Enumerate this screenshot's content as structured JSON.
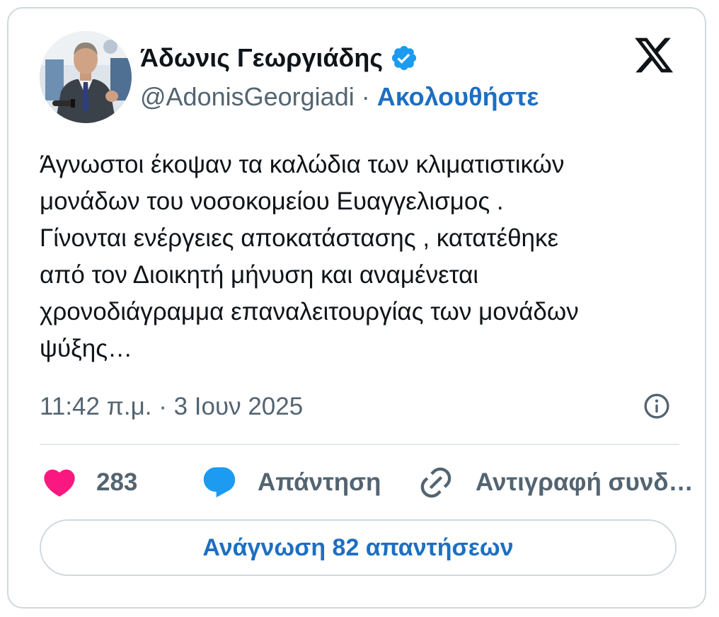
{
  "author": {
    "display_name": "Άδωνις Γεωργιάδης",
    "handle": "@AdonisGeorgiadi",
    "separator": "·",
    "follow_label": "Ακολουθήστε"
  },
  "tweet": {
    "text": "Άγνωστοι έκοψαν τα καλώδια των κλιματιστικών\nμονάδων του νοσοκομείου Ευαγγελισμος .\nΓίνονται ενέργειες αποκατάστασης , κατατέθηκε\nαπό τον Διοικητή μήνυση και αναμένεται\nχρονοδιάγραμμα επαναλειτουργίας των μονάδων\nψύξης…",
    "timestamp": "11:42 π.μ. · 3 Ιουν 2025"
  },
  "actions": {
    "like_count": "283",
    "reply_label": "Απάντηση",
    "copy_link_label": "Αντιγραφή συνδ…"
  },
  "read_replies_label": "Ανάγνωση 82 απαντήσεων",
  "icons": {
    "verified": "verified-badge-icon",
    "brand": "x-logo-icon",
    "info": "info-icon",
    "like": "heart-icon",
    "reply": "speech-bubble-icon",
    "copy": "link-icon"
  },
  "colors": {
    "accent_blue": "#1d6fc2",
    "verified_blue": "#1d9bf0",
    "like_pink": "#f91880",
    "text_primary": "#0f1419",
    "text_secondary": "#536471",
    "border": "#cfd9de"
  }
}
